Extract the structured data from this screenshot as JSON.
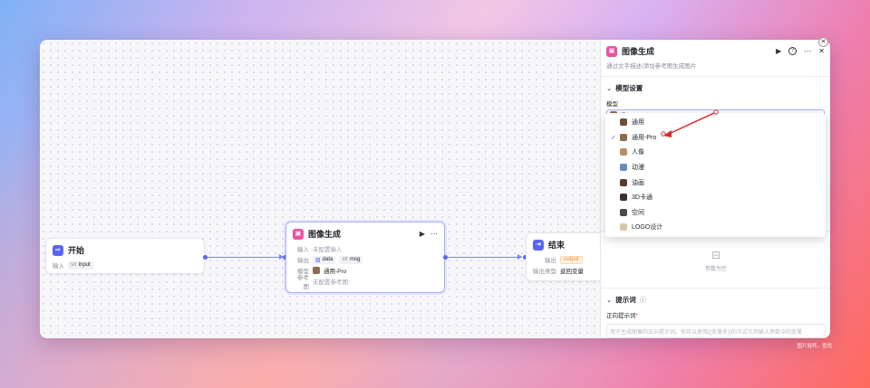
{
  "colors": {
    "accent": "#5865f2",
    "image_node_icon": "#f04fa0",
    "annotation_arrow": "#d9282f"
  },
  "nodes": {
    "start": {
      "title": "开始",
      "input_label": "输入",
      "input_type": "str",
      "input_name": "input"
    },
    "image": {
      "title": "图像生成",
      "input_label": "输入",
      "input_value": "未配置输入",
      "output_label": "输出",
      "output_tags": [
        {
          "type_icon": "image-icon",
          "name": "data"
        },
        {
          "type": "str",
          "name": "msg"
        }
      ],
      "model_label": "模型",
      "model_value": "通用-Pro",
      "ref_label": "参考图",
      "ref_value": "未配置参考图"
    },
    "end": {
      "title": "结束",
      "output_label": "输出",
      "output_tag": "output",
      "type_label": "输出类型",
      "type_value": "返回变量"
    }
  },
  "panel": {
    "title": "图像生成",
    "description": "通过文字描述/添加参考图生成图片",
    "model_section": "模型设置",
    "model_field": "模型",
    "selected_model": "通用-Pro",
    "options": [
      {
        "label": "通用",
        "color": "#6b4f3a",
        "selected": false
      },
      {
        "label": "通用-Pro",
        "color": "#8a6b4e",
        "selected": true
      },
      {
        "label": "人像",
        "color": "#c28a6a",
        "selected": false
      },
      {
        "label": "动漫",
        "color": "#6a8ac2",
        "selected": false
      },
      {
        "label": "油画",
        "color": "#5a3a2a",
        "selected": false
      },
      {
        "label": "3D卡通",
        "color": "#3a3030",
        "selected": false
      },
      {
        "label": "空间",
        "color": "#4a4a4a",
        "selected": false
      },
      {
        "label": "LOGO设计",
        "color": "#d9c8a8",
        "selected": false
      }
    ],
    "empty_text": "参数为空",
    "prompt_section": "提示词",
    "positive_prompt_label": "正向提示词",
    "prompt_placeholder": "用于生成图像的正向提示词。你可以使用{{变量名}}的方式引用输入参数中的变量"
  },
  "credit": "图片旋转，查找"
}
